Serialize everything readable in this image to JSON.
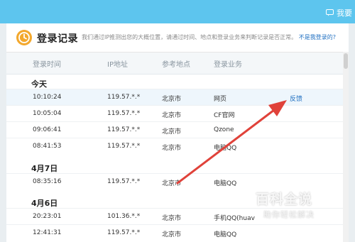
{
  "topbar": {
    "text": "我要"
  },
  "header": {
    "title": "登录记录",
    "description": "我们通过IP推测出您的大概位置，请通过时间、地点和登录业务来判断记录是否正常。",
    "not_me_link": "不是我登录的?"
  },
  "columns": [
    "登录时间",
    "IP地址",
    "参考地点",
    "登录业务"
  ],
  "sections": [
    {
      "label": "今天",
      "rows": [
        {
          "time": "10:10:24",
          "ip": "119.57.*.*",
          "location": "北京市",
          "service": "网页",
          "action": "反馈"
        },
        {
          "time": "10:05:04",
          "ip": "119.57.*.*",
          "location": "北京市",
          "service": "CF官网"
        },
        {
          "time": "09:06:41",
          "ip": "119.57.*.*",
          "location": "北京市",
          "service": "Qzone"
        },
        {
          "time": "08:41:53",
          "ip": "119.57.*.*",
          "location": "北京市",
          "service": "电脑QQ"
        }
      ]
    },
    {
      "label": "4月7日",
      "rows": [
        {
          "time": "08:35:16",
          "ip": "119.57.*.*",
          "location": "北京市",
          "service": "电脑QQ"
        }
      ]
    },
    {
      "label": "4月6日",
      "rows": [
        {
          "time": "20:23:01",
          "ip": "101.36.*.*",
          "location": "北京市",
          "service": "手机QQ(huav"
        },
        {
          "time": "12:41:31",
          "ip": "119.57.*.*",
          "location": "北京市",
          "service": "电脑QQ"
        }
      ]
    }
  ],
  "watermark": {
    "title": "百科全说",
    "subtitle": "助你轻松解决"
  },
  "colors": {
    "topbar": "#5dc5ee",
    "clock": "#f3a82d",
    "link": "#1f6fc1",
    "arrow": "#e0423a"
  },
  "icons": {
    "clock": "clock-icon",
    "topbar": "chat-icon"
  }
}
